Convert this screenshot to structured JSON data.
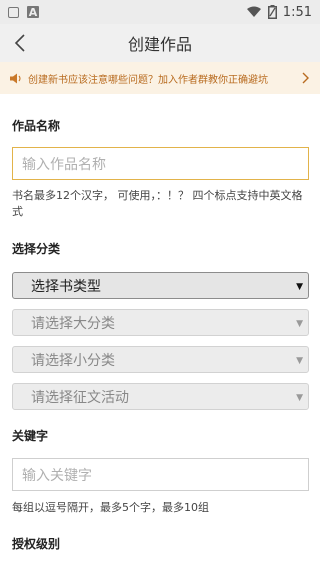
{
  "status_bar": {
    "time": "1:51",
    "left_icons": [
      "image-icon",
      "a-icon"
    ],
    "right_icons": [
      "wifi-icon",
      "battery-icon"
    ]
  },
  "header": {
    "title": "创建作品",
    "back_icon": "chevron-left-icon"
  },
  "notice": {
    "text": "创建新书应该注意哪些问题？加入作者群教你正确避坑",
    "icon": "speaker-icon",
    "arrow_icon": "chevron-right-icon",
    "color": "#b86b1f",
    "background": "#fbf2e4"
  },
  "work_name": {
    "label": "作品名称",
    "placeholder": "输入作品名称",
    "hint": "书名最多12个汉字， 可使用，：！？ 四个标点支持中英文格式"
  },
  "category": {
    "label": "选择分类",
    "book_type": "选择书类型",
    "major": "请选择大分类",
    "minor": "请选择小分类",
    "contest": "请选择征文活动"
  },
  "keywords": {
    "label": "关键字",
    "placeholder": "输入关键字",
    "hint": "每组以逗号隔开，最多5个字，最多10组"
  },
  "license": {
    "label": "授权级别"
  },
  "colors": {
    "accent_border": "#e2b34a",
    "app_bar": "#f0f0f0"
  }
}
